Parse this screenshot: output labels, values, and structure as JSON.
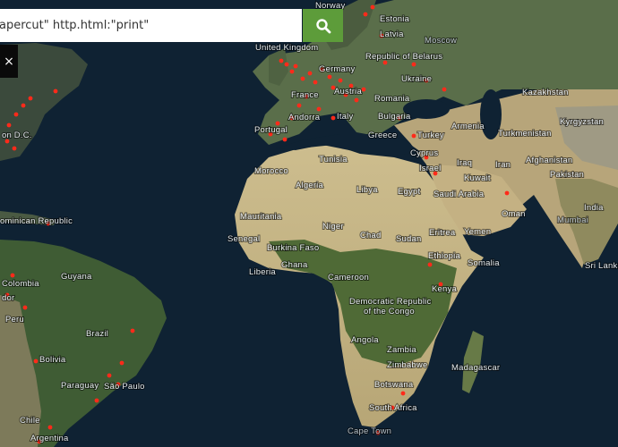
{
  "search": {
    "value": "apercut\" http.html:\"print\"",
    "button_icon": "search-icon",
    "button_color": "#5d9c3a"
  },
  "close_button": {
    "label": "×",
    "icon": "close-icon"
  },
  "map": {
    "ocean_color": "#0f2233",
    "marker_color": "#ff2a1a",
    "labels": {
      "norway": "Norway",
      "estonia": "Estonia",
      "latvia": "Latvia",
      "moscow": "Moscow",
      "united_kingdom": "United Kingdom",
      "republic_of_belarus": "Republic of Belarus",
      "germany": "Germany",
      "ukraine": "Ukraine",
      "france": "France",
      "austria": "Austria",
      "romania": "Romania",
      "kazakhstan": "Kazakhstan",
      "andorra": "Andorra",
      "italy": "Italy",
      "bulgaria": "Bulgaria",
      "portugal": "Portugal",
      "armenia": "Armenia",
      "kyrgyzstan": "Kyrgyzstan",
      "greece": "Greece",
      "turkey": "Turkey",
      "turkmenistan": "Turkmenistan",
      "washington": "on D.C.",
      "tunisia": "Tunisia",
      "cyprus": "Cyprus",
      "iraq": "Iraq",
      "iran": "Iran",
      "afghanistan": "Afghanistan",
      "israel": "Israel",
      "morocco": "Morocco",
      "kuwait": "Kuwait",
      "pakistan": "Pakistan",
      "algeria": "Algeria",
      "libya": "Libya",
      "egypt": "Egypt",
      "saudi_arabia": "Saudi Arabia",
      "india": "India",
      "oman": "Oman",
      "mauritania": "Mauritania",
      "mumbai": "Mumbai",
      "dominican_republic": "ominican Republic",
      "niger": "Niger",
      "senegal": "Senegal",
      "chad": "Chad",
      "sudan": "Sudan",
      "eritrea": "Eritrea",
      "yemen": "Yemen",
      "burkina_faso": "Burkina Faso",
      "ethiopia": "Ethiopia",
      "ghana": "Ghana",
      "somalia": "Somalia",
      "sri_lanka": "Sri Lanka",
      "liberia": "Liberia",
      "guyana": "Guyana",
      "cameroon": "Cameroon",
      "colombia": "Colombia",
      "dor": "dor",
      "kenya": "Kenya",
      "drc_line1": "Democratic Republic",
      "drc_line2": "of the Congo",
      "peru": "Peru",
      "brazil": "Brazil",
      "angola": "Angola",
      "zambia": "Zambia",
      "bolivia": "Bolivia",
      "zimbabwe": "Zimbabwe",
      "madagascar": "Madagascar",
      "paraguay": "Paraguay",
      "sao_paulo": "São Paulo",
      "botswana": "Botswana",
      "south_africa": "South Africa",
      "chile": "Chile",
      "argentina": "Argentina",
      "cape_town": "Cape Town"
    }
  }
}
